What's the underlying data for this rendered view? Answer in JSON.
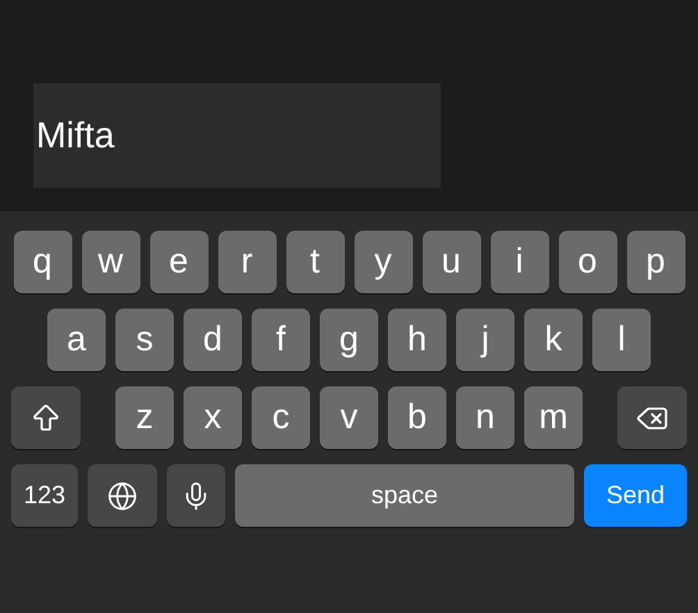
{
  "text_field": {
    "value": "Mifta"
  },
  "keyboard": {
    "rows": [
      {
        "keys": [
          {
            "kind": "letter",
            "label": "q"
          },
          {
            "kind": "letter",
            "label": "w"
          },
          {
            "kind": "letter",
            "label": "e"
          },
          {
            "kind": "letter",
            "label": "r"
          },
          {
            "kind": "letter",
            "label": "t"
          },
          {
            "kind": "letter",
            "label": "y"
          },
          {
            "kind": "letter",
            "label": "u"
          },
          {
            "kind": "letter",
            "label": "i"
          },
          {
            "kind": "letter",
            "label": "o"
          },
          {
            "kind": "letter",
            "label": "p"
          }
        ]
      },
      {
        "keys": [
          {
            "kind": "letter",
            "label": "a"
          },
          {
            "kind": "letter",
            "label": "s"
          },
          {
            "kind": "letter",
            "label": "d"
          },
          {
            "kind": "letter",
            "label": "f"
          },
          {
            "kind": "letter",
            "label": "g"
          },
          {
            "kind": "letter",
            "label": "h"
          },
          {
            "kind": "letter",
            "label": "j"
          },
          {
            "kind": "letter",
            "label": "k"
          },
          {
            "kind": "letter",
            "label": "l"
          }
        ]
      },
      {
        "keys": [
          {
            "kind": "shift"
          },
          {
            "kind": "letter",
            "label": "z"
          },
          {
            "kind": "letter",
            "label": "x"
          },
          {
            "kind": "letter",
            "label": "c"
          },
          {
            "kind": "letter",
            "label": "v"
          },
          {
            "kind": "letter",
            "label": "b"
          },
          {
            "kind": "letter",
            "label": "n"
          },
          {
            "kind": "letter",
            "label": "m"
          },
          {
            "kind": "delete"
          }
        ]
      },
      {
        "keys": [
          {
            "kind": "numbers",
            "label": "123"
          },
          {
            "kind": "globe"
          },
          {
            "kind": "mic"
          },
          {
            "kind": "space",
            "label": "space"
          },
          {
            "kind": "send",
            "label": "Send"
          }
        ]
      }
    ]
  }
}
